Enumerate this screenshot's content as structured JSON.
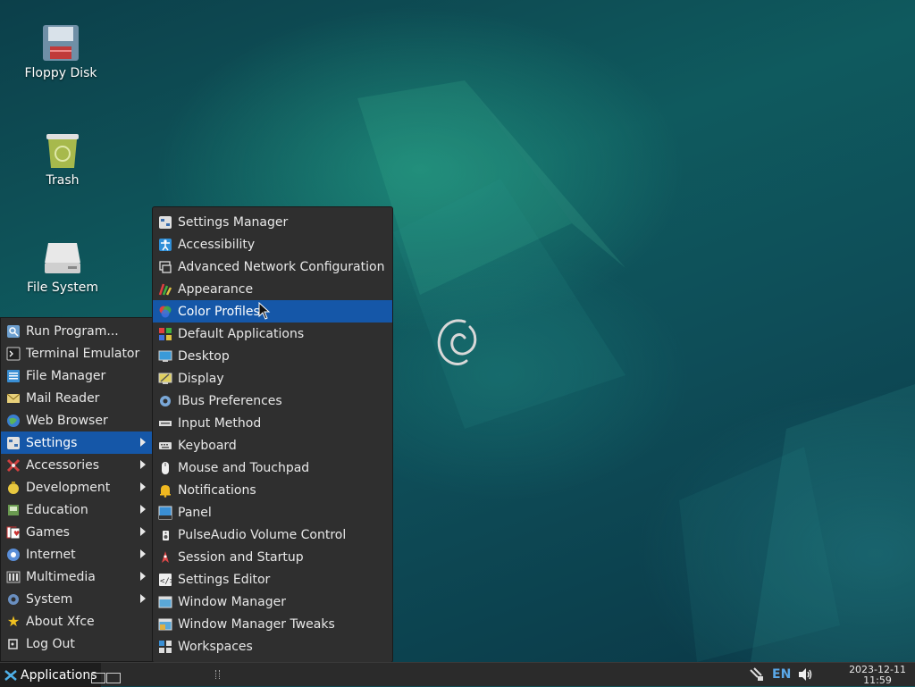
{
  "desktop": {
    "icons": [
      {
        "label": "Floppy Disk",
        "icon": "floppy-disk-icon"
      },
      {
        "label": "Trash",
        "icon": "trash-icon"
      },
      {
        "label": "File System",
        "icon": "hard-drive-icon"
      }
    ]
  },
  "app_menu": {
    "items": [
      {
        "label": "Run Program...",
        "icon": "run-icon",
        "submenu": false
      },
      {
        "label": "Terminal Emulator",
        "icon": "terminal-icon",
        "submenu": false
      },
      {
        "label": "File Manager",
        "icon": "file-manager-icon",
        "submenu": false
      },
      {
        "label": "Mail Reader",
        "icon": "mail-icon",
        "submenu": false
      },
      {
        "label": "Web Browser",
        "icon": "globe-icon",
        "submenu": false
      },
      {
        "label": "Settings",
        "icon": "settings-icon",
        "submenu": true,
        "selected": true
      },
      {
        "label": "Accessories",
        "icon": "accessories-icon",
        "submenu": true
      },
      {
        "label": "Development",
        "icon": "development-icon",
        "submenu": true
      },
      {
        "label": "Education",
        "icon": "education-icon",
        "submenu": true
      },
      {
        "label": "Games",
        "icon": "games-icon",
        "submenu": true
      },
      {
        "label": "Internet",
        "icon": "internet-icon",
        "submenu": true
      },
      {
        "label": "Multimedia",
        "icon": "multimedia-icon",
        "submenu": true
      },
      {
        "label": "System",
        "icon": "system-gear-icon",
        "submenu": true
      },
      {
        "label": "About Xfce",
        "icon": "star-icon",
        "submenu": false
      },
      {
        "label": "Log Out",
        "icon": "logout-icon",
        "submenu": false
      }
    ]
  },
  "settings_menu": {
    "items": [
      {
        "label": "Settings Manager",
        "icon": "settings-manager-icon"
      },
      {
        "label": "Accessibility",
        "icon": "accessibility-icon"
      },
      {
        "label": "Advanced Network Configuration",
        "icon": "network-icon"
      },
      {
        "label": "Appearance",
        "icon": "appearance-icon"
      },
      {
        "label": "Color Profiles",
        "icon": "color-profiles-icon",
        "selected": true
      },
      {
        "label": "Default Applications",
        "icon": "default-apps-icon"
      },
      {
        "label": "Desktop",
        "icon": "desktop-icon"
      },
      {
        "label": "Display",
        "icon": "display-icon"
      },
      {
        "label": "IBus Preferences",
        "icon": "ibus-gear-icon"
      },
      {
        "label": "Input Method",
        "icon": "input-method-icon"
      },
      {
        "label": "Keyboard",
        "icon": "keyboard-icon"
      },
      {
        "label": "Mouse and Touchpad",
        "icon": "mouse-icon"
      },
      {
        "label": "Notifications",
        "icon": "bell-icon"
      },
      {
        "label": "Panel",
        "icon": "panel-icon"
      },
      {
        "label": "PulseAudio Volume Control",
        "icon": "volume-control-icon"
      },
      {
        "label": "Session and Startup",
        "icon": "session-icon"
      },
      {
        "label": "Settings Editor",
        "icon": "settings-editor-icon"
      },
      {
        "label": "Window Manager",
        "icon": "window-manager-icon"
      },
      {
        "label": "Window Manager Tweaks",
        "icon": "window-tweaks-icon"
      },
      {
        "label": "Workspaces",
        "icon": "workspaces-icon"
      }
    ]
  },
  "panel": {
    "applications_label": "Applications",
    "keyboard_layout": "EN",
    "clock_date": "2023-12-11",
    "clock_time": "11:59"
  },
  "colors": {
    "selection": "#1557a8",
    "menu_bg": "#2f2f2f",
    "panel_bg": "#2b2b2b"
  }
}
